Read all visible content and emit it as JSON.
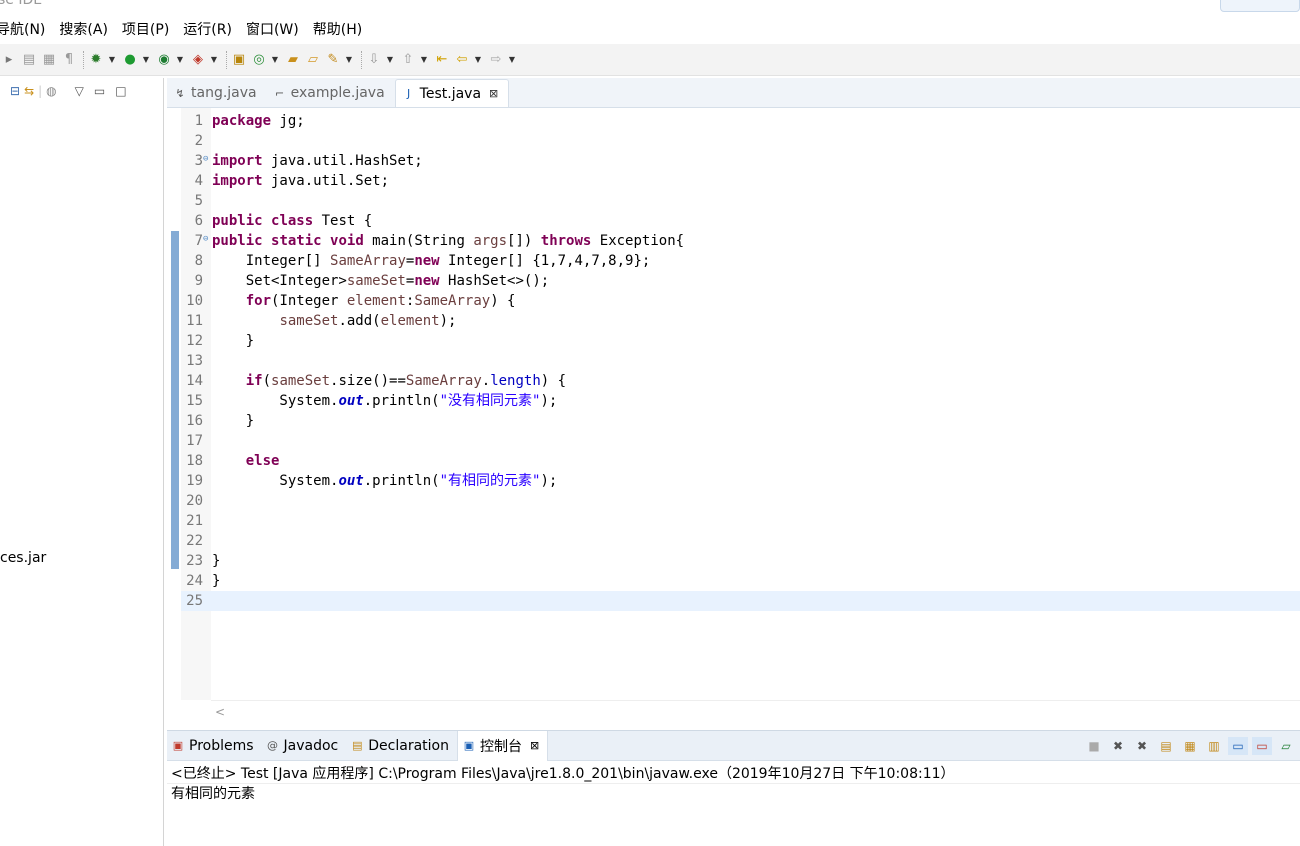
{
  "window": {
    "title_fragment": "se IDE"
  },
  "menu": [
    "导航(N)",
    "搜索(A)",
    "项目(P)",
    "运行(R)",
    "窗口(W)",
    "帮助(H)"
  ],
  "left_panel": {
    "jar_label": "ces.jar"
  },
  "editor_tabs": [
    {
      "label": "tang.java",
      "active": false
    },
    {
      "label": "example.java",
      "active": false
    },
    {
      "label": "Test.java",
      "active": true
    }
  ],
  "code": {
    "current_line": 25,
    "line_numbers": [
      "1",
      "2",
      "3",
      "4",
      "5",
      "6",
      "7",
      "8",
      "9",
      "10",
      "11",
      "12",
      "13",
      "14",
      "15",
      "16",
      "17",
      "18",
      "19",
      "20",
      "21",
      "22",
      "23",
      "24",
      "25"
    ],
    "lines": [
      [
        {
          "k": "kw",
          "t": "package"
        },
        {
          "k": "",
          "t": " jg;"
        }
      ],
      [],
      [
        {
          "k": "kw",
          "t": "import"
        },
        {
          "k": "",
          "t": " java.util.HashSet;"
        }
      ],
      [
        {
          "k": "kw",
          "t": "import"
        },
        {
          "k": "",
          "t": " java.util.Set;"
        }
      ],
      [],
      [
        {
          "k": "kw",
          "t": "public"
        },
        {
          "k": "",
          "t": " "
        },
        {
          "k": "kw",
          "t": "class"
        },
        {
          "k": "",
          "t": " Test {"
        }
      ],
      [
        {
          "k": "kw",
          "t": "public"
        },
        {
          "k": "",
          "t": " "
        },
        {
          "k": "kw",
          "t": "static"
        },
        {
          "k": "",
          "t": " "
        },
        {
          "k": "kw",
          "t": "void"
        },
        {
          "k": "",
          "t": " main(String "
        },
        {
          "k": "var",
          "t": "args"
        },
        {
          "k": "",
          "t": "[]) "
        },
        {
          "k": "kw",
          "t": "throws"
        },
        {
          "k": "",
          "t": " Exception{"
        }
      ],
      [
        {
          "k": "",
          "t": "    Integer[] "
        },
        {
          "k": "var",
          "t": "SameArray"
        },
        {
          "k": "",
          "t": "="
        },
        {
          "k": "kw",
          "t": "new"
        },
        {
          "k": "",
          "t": " Integer[] {1,7,4,7,8,9};"
        }
      ],
      [
        {
          "k": "",
          "t": "    Set<Integer>"
        },
        {
          "k": "var",
          "t": "sameSet"
        },
        {
          "k": "",
          "t": "="
        },
        {
          "k": "kw",
          "t": "new"
        },
        {
          "k": "",
          "t": " HashSet<>();"
        }
      ],
      [
        {
          "k": "",
          "t": "    "
        },
        {
          "k": "kw",
          "t": "for"
        },
        {
          "k": "",
          "t": "(Integer "
        },
        {
          "k": "var",
          "t": "element"
        },
        {
          "k": "",
          "t": ":"
        },
        {
          "k": "var",
          "t": "SameArray"
        },
        {
          "k": "",
          "t": ") {"
        }
      ],
      [
        {
          "k": "",
          "t": "        "
        },
        {
          "k": "var",
          "t": "sameSet"
        },
        {
          "k": "",
          "t": ".add("
        },
        {
          "k": "var",
          "t": "element"
        },
        {
          "k": "",
          "t": ");"
        }
      ],
      [
        {
          "k": "",
          "t": "    }"
        }
      ],
      [],
      [
        {
          "k": "",
          "t": "    "
        },
        {
          "k": "kw",
          "t": "if"
        },
        {
          "k": "",
          "t": "("
        },
        {
          "k": "var",
          "t": "sameSet"
        },
        {
          "k": "",
          "t": ".size()=="
        },
        {
          "k": "var",
          "t": "SameArray"
        },
        {
          "k": "",
          "t": "."
        },
        {
          "k": "fld",
          "t": "length"
        },
        {
          "k": "",
          "t": ") {"
        }
      ],
      [
        {
          "k": "",
          "t": "        System."
        },
        {
          "k": "sfld",
          "t": "out"
        },
        {
          "k": "",
          "t": ".println("
        },
        {
          "k": "str",
          "t": "\"没有相同元素\""
        },
        {
          "k": "",
          "t": ");"
        }
      ],
      [
        {
          "k": "",
          "t": "    }"
        }
      ],
      [],
      [
        {
          "k": "",
          "t": "    "
        },
        {
          "k": "kw",
          "t": "else"
        }
      ],
      [
        {
          "k": "",
          "t": "        System."
        },
        {
          "k": "sfld",
          "t": "out"
        },
        {
          "k": "",
          "t": ".println("
        },
        {
          "k": "str",
          "t": "\"有相同的元素\""
        },
        {
          "k": "",
          "t": ");"
        }
      ],
      [],
      [],
      [],
      [
        {
          "k": "",
          "t": "}"
        }
      ],
      [
        {
          "k": "",
          "t": "}"
        }
      ],
      []
    ]
  },
  "console": {
    "tabs": [
      {
        "label": "Problems",
        "icon": "problems-icon"
      },
      {
        "label": "Javadoc",
        "icon": "at-icon"
      },
      {
        "label": "Declaration",
        "icon": "declaration-icon"
      },
      {
        "label": "控制台",
        "icon": "console-icon",
        "active": true
      }
    ],
    "header": "<已终止> Test [Java 应用程序] C:\\Program Files\\Java\\jre1.8.0_201\\bin\\javaw.exe（2019年10月27日 下午10:08:11）",
    "output": "有相同的元素"
  },
  "colors": {
    "keyword": "#7f0055",
    "string": "#2a00ff",
    "field": "#0000c0",
    "local_var": "#6a3e3e",
    "current_line": "#e8f2fe"
  }
}
